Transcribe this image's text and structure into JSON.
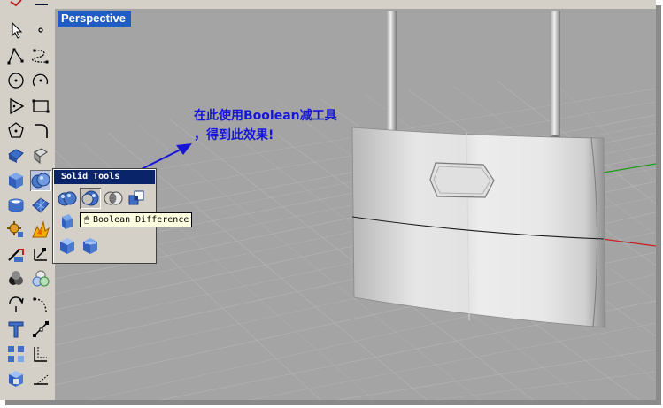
{
  "viewport": {
    "title": "Perspective"
  },
  "annotation": {
    "line1": "在此使用Boolean减工具",
    "line2": "，得到此效果!"
  },
  "solid_tools": {
    "title": "Solid Tools",
    "tooltip": "Boolean Difference"
  },
  "toolbar": {
    "tools": [
      "select-arrow-icon",
      "point-icon",
      "polyline-icon",
      "curve-icon",
      "circle-icon",
      "arc-icon",
      "ellipse-icon",
      "rectangle-icon",
      "polygon-icon",
      "fillet-icon",
      "surface-icon",
      "extrude-icon",
      "box-icon",
      "solid-boolean-icon",
      "cylinder-icon",
      "mesh-icon",
      "transform-icon",
      "explode-icon",
      "trim-icon",
      "split-icon",
      "group-icon",
      "array-icon",
      "rotate-icon",
      "bend-icon",
      "text-icon",
      "dimension-icon",
      "layers-icon",
      "offset-icon",
      "render-icon",
      "snap-icon"
    ]
  },
  "colors": {
    "viewport_bg": "#a4a4a4",
    "title_bar": "#1f5cc4",
    "annotation_text": "#1616d9",
    "panel_title": "#0a246a"
  }
}
